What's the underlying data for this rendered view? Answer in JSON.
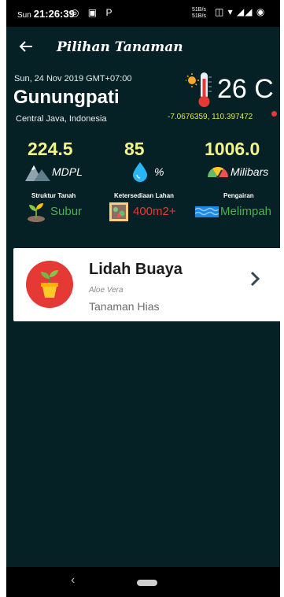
{
  "status_bar": {
    "day": "Sun",
    "time": "21:26:39",
    "left_icons": "◎ ▣ P",
    "speed_up": "51B/s",
    "speed_down": "51B/s",
    "right_icons": "◫ ▾ ◢◢ ◉"
  },
  "app_bar": {
    "back_icon": "arrow-left-icon",
    "title": "Pilihan Tanaman"
  },
  "info": {
    "date": "Sun, 24 Nov 2019 GMT+07:00",
    "location": "Gunungpati",
    "region": "Central Java, Indonesia",
    "temperature": "26 C",
    "coordinates": "-7.0676359, 110.397472"
  },
  "stats": {
    "altitude": {
      "value": "224.5",
      "unit": "MDPL"
    },
    "humidity": {
      "value": "85",
      "unit": "%"
    },
    "pressure": {
      "value": "1006.0",
      "unit": "Milibars"
    }
  },
  "conditions": {
    "soil": {
      "label": "Struktur Tanah",
      "value": "Subur",
      "color": "#4caf50"
    },
    "land": {
      "label": "Ketersediaan Lahan",
      "value": "400m2+",
      "color": "#e53935"
    },
    "water": {
      "label": "Pengairan",
      "value": "Melimpah",
      "color": "#4caf50"
    }
  },
  "plants": [
    {
      "name": "Lidah Buaya",
      "latin": "Aloe Vera",
      "category": "Tanaman Hias"
    }
  ],
  "colors": {
    "background": "#062126",
    "stat_value": "#f3f38a",
    "coords": "#d9e35a",
    "card": "#ffffff"
  }
}
